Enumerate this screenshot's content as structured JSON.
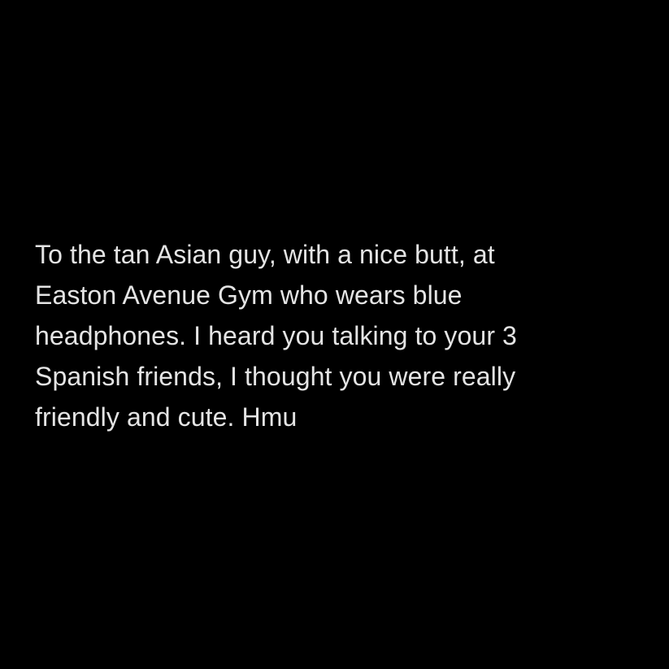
{
  "post": {
    "lines": [
      "To the tan Asian guy, with a nice butt, at",
      "Easton Avenue Gym who wears blue",
      "headphones. I heard you talking to your 3",
      "Spanish friends, I thought you were really",
      "friendly and cute. Hmu"
    ]
  },
  "colors": {
    "background": "#000000",
    "text": "#e4e4e4"
  }
}
